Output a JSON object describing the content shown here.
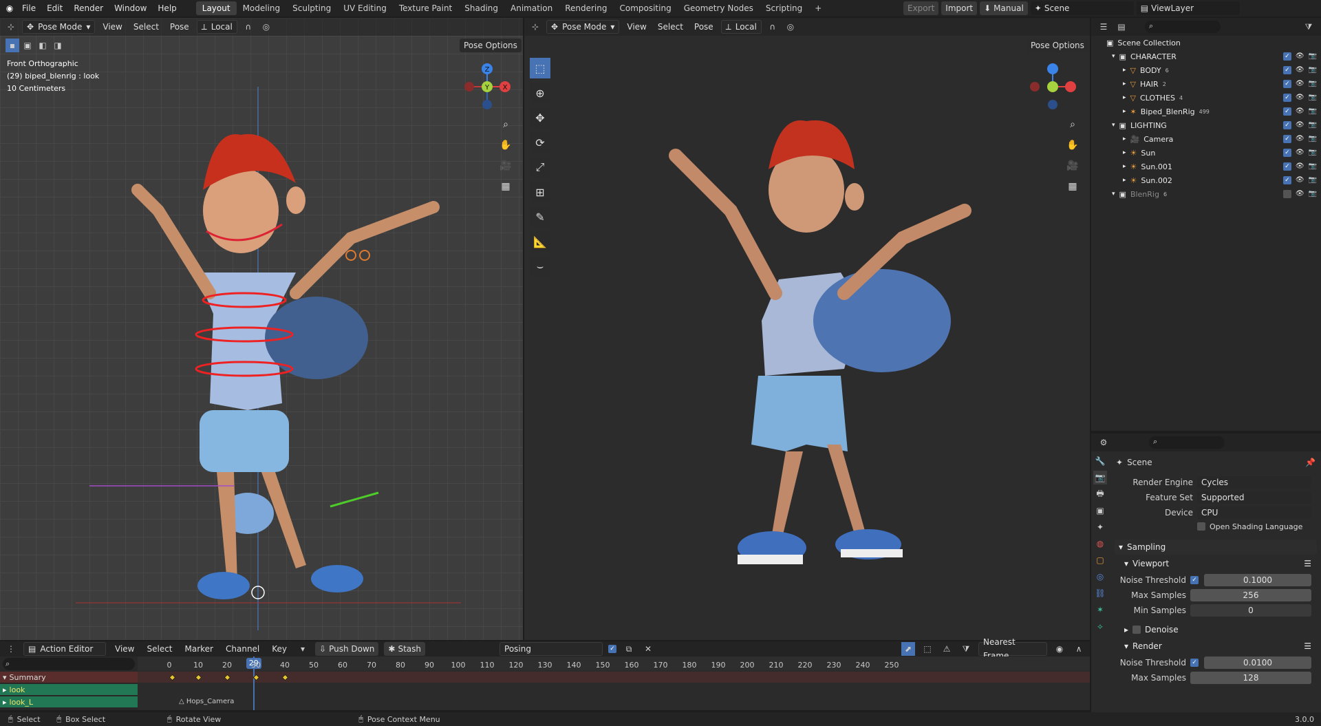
{
  "topbar": {
    "menus": [
      "File",
      "Edit",
      "Render",
      "Window",
      "Help"
    ],
    "workspaces": [
      "Layout",
      "Modeling",
      "Sculpting",
      "UV Editing",
      "Texture Paint",
      "Shading",
      "Animation",
      "Rendering",
      "Compositing",
      "Geometry Nodes",
      "Scripting"
    ],
    "active_workspace": "Layout",
    "export_label": "Export",
    "import_label": "Import",
    "manual_label": "Manual",
    "scene": "Scene",
    "view_layer": "ViewLayer"
  },
  "left_viewport": {
    "mode": "Pose Mode",
    "menus": [
      "View",
      "Select",
      "Pose"
    ],
    "orientation": "Local",
    "pose_options": "Pose Options",
    "overlay_lines": [
      "Front Orthographic",
      "(29) biped_blenrig : look",
      "10 Centimeters"
    ]
  },
  "right_viewport": {
    "mode": "Pose Mode",
    "menus": [
      "View",
      "Select",
      "Pose"
    ],
    "orientation": "Local",
    "pose_options": "Pose Options"
  },
  "gizmo": {
    "z": "Z",
    "y": "Y",
    "x": "X"
  },
  "outliner": {
    "root": "Scene Collection",
    "items": [
      {
        "label": "CHARACTER",
        "depth": 0,
        "icon": "collection-icon",
        "count": ""
      },
      {
        "label": "BODY",
        "depth": 1,
        "icon": "mesh-icon",
        "count": "6"
      },
      {
        "label": "HAIR",
        "depth": 1,
        "icon": "mesh-icon",
        "count": "2"
      },
      {
        "label": "CLOTHES",
        "depth": 1,
        "icon": "mesh-icon",
        "count": "4"
      },
      {
        "label": "Biped_BlenRig",
        "depth": 1,
        "icon": "armature-icon",
        "count": "499"
      },
      {
        "label": "LIGHTING",
        "depth": 0,
        "icon": "collection-icon",
        "count": ""
      },
      {
        "label": "Camera",
        "depth": 1,
        "icon": "camera-icon",
        "count": ""
      },
      {
        "label": "Sun",
        "depth": 1,
        "icon": "light-icon",
        "count": ""
      },
      {
        "label": "Sun.001",
        "depth": 1,
        "icon": "light-icon",
        "count": ""
      },
      {
        "label": "Sun.002",
        "depth": 1,
        "icon": "light-icon",
        "count": ""
      },
      {
        "label": "BlenRig",
        "depth": 0,
        "icon": "collection-icon",
        "count": "6"
      }
    ]
  },
  "properties": {
    "title": "Scene",
    "render_engine_label": "Render Engine",
    "render_engine": "Cycles",
    "feature_set_label": "Feature Set",
    "feature_set": "Supported",
    "device_label": "Device",
    "device": "CPU",
    "osl_label": "Open Shading Language",
    "sampling": "Sampling",
    "viewport": "Viewport",
    "noise_threshold_label": "Noise Threshold",
    "viewport_noise_threshold": "0.1000",
    "max_samples_label": "Max Samples",
    "viewport_max_samples": "256",
    "min_samples_label": "Min Samples",
    "viewport_min_samples": "0",
    "denoise": "Denoise",
    "render": "Render",
    "render_noise_threshold": "0.0100",
    "render_max_samples": "128"
  },
  "timeline": {
    "editor": "Action Editor",
    "menus": [
      "View",
      "Select",
      "Marker",
      "Channel",
      "Key"
    ],
    "push_down": "Push Down",
    "stash": "Stash",
    "action": "Posing",
    "snap": "Nearest Frame",
    "current_frame": "29",
    "ticks": [
      "0",
      "10",
      "20",
      "30",
      "40",
      "50",
      "60",
      "70",
      "80",
      "90",
      "100",
      "110",
      "120",
      "130",
      "140",
      "150",
      "160",
      "170",
      "180",
      "190",
      "200",
      "210",
      "220",
      "230",
      "240",
      "250"
    ],
    "channels": [
      "Summary",
      "look",
      "look_L"
    ],
    "marker": "Hops_Camera",
    "keyframes": [
      1,
      10,
      20,
      30,
      40
    ]
  },
  "statusbar": {
    "select": "Select",
    "box_select": "Box Select",
    "rotate_view": "Rotate View",
    "context_menu": "Pose Context Menu",
    "version": "3.0.0"
  }
}
